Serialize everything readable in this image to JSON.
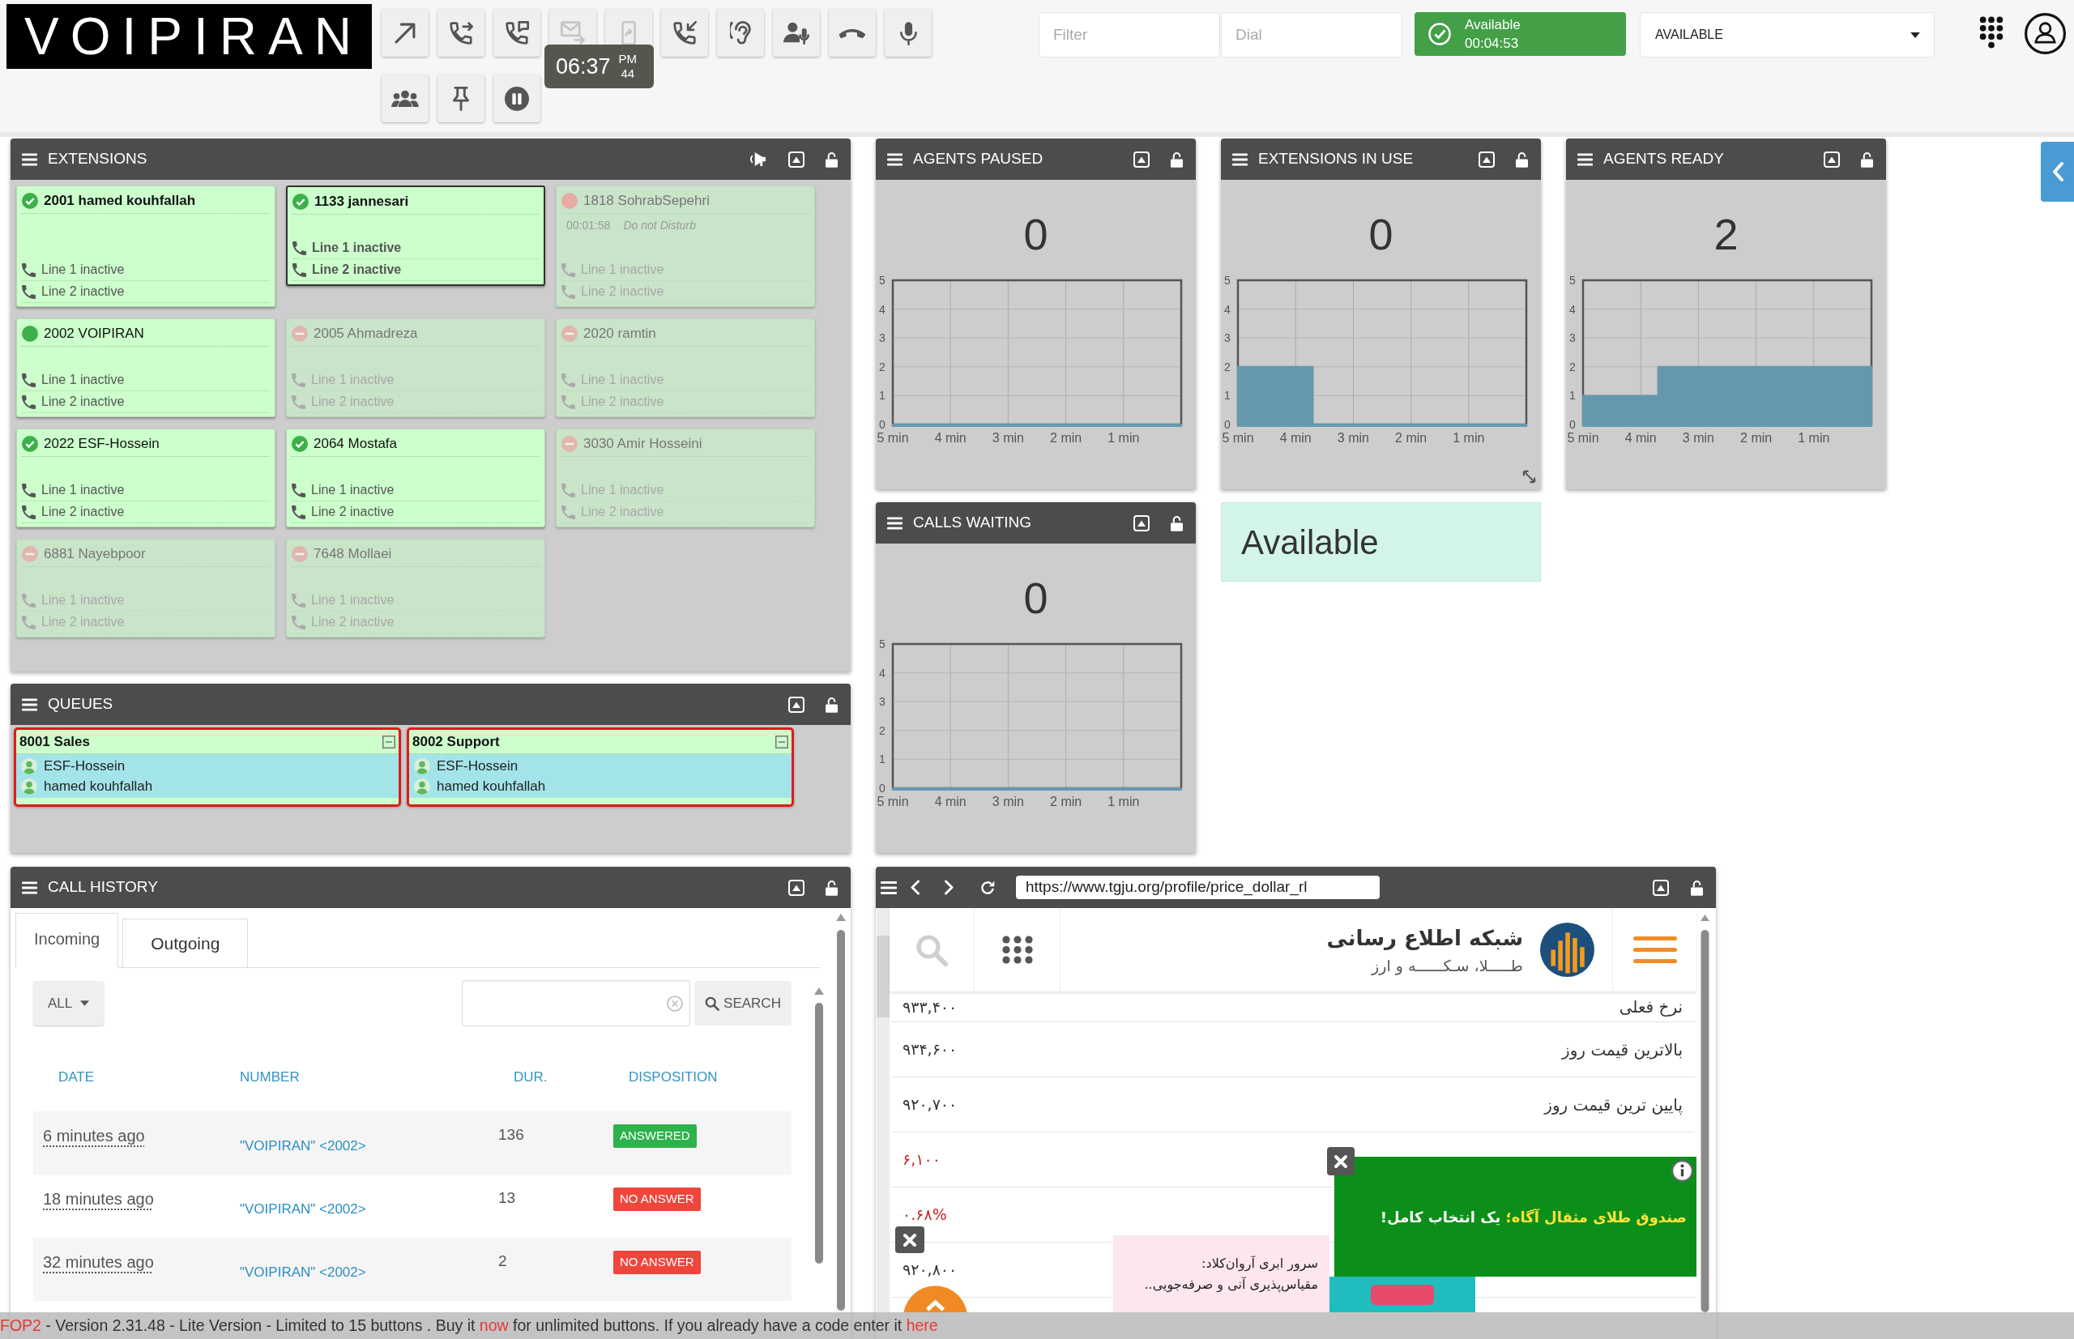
{
  "topbar": {
    "logo": "VOIPIRAN",
    "toolbar": [
      {
        "kind": "arrow",
        "disabled": false
      },
      {
        "kind": "transfer",
        "disabled": false
      },
      {
        "kind": "voicemail",
        "disabled": false
      },
      {
        "kind": "mail",
        "disabled": true
      },
      {
        "kind": "mobile",
        "disabled": true
      },
      {
        "kind": "pickup",
        "disabled": false
      },
      {
        "kind": "listen",
        "disabled": false
      },
      {
        "kind": "whisper",
        "disabled": false
      },
      {
        "kind": "hangup",
        "disabled": false
      },
      {
        "kind": "mic",
        "disabled": false
      },
      {
        "kind": "group",
        "disabled": false
      },
      {
        "kind": "pin",
        "disabled": false
      },
      {
        "kind": "pause",
        "disabled": false
      }
    ],
    "clock": {
      "time": "06:37",
      "period": "PM",
      "seconds": "44"
    },
    "filter": {
      "placeholder": "Filter"
    },
    "dial": {
      "placeholder": "Dial"
    },
    "presence_button": {
      "label": "Available",
      "timer": "00:04:53"
    },
    "presence_select": {
      "value": "AVAILABLE"
    }
  },
  "extensions": {
    "title": "EXTENSIONS",
    "items": [
      {
        "name": "2001 hamed kouhfallah",
        "kind": "available",
        "selected": false,
        "bold": true,
        "lines": [
          {
            "label": "Line 1 inactive",
            "bold": false
          },
          {
            "label": "Line 2 inactive",
            "bold": false
          }
        ]
      },
      {
        "name": "1133 jannesari",
        "kind": "available",
        "selected": true,
        "bold": true,
        "lines": [
          {
            "label": "Line 1 inactive",
            "bold": true
          },
          {
            "label": "Line 2 inactive",
            "bold": true
          }
        ]
      },
      {
        "name": "1818 SohrabSepehri",
        "kind": "dnd",
        "selected": false,
        "bold": false,
        "timer": "00:01:58",
        "note": "Do not Disturb",
        "lines": [
          {
            "label": "Line 1 inactive",
            "bold": false
          },
          {
            "label": "Line 2 inactive",
            "bold": false
          }
        ]
      },
      {
        "name": "2002 VOIPIRAN",
        "kind": "online",
        "selected": false,
        "bold": false,
        "lines": [
          {
            "label": "Line 1 inactive",
            "bold": false
          },
          {
            "label": "Line 2 inactive",
            "bold": false
          }
        ]
      },
      {
        "name": "2005 Ahmadreza",
        "kind": "offline",
        "selected": false,
        "bold": false,
        "lines": [
          {
            "label": "Line 1 inactive",
            "bold": false
          },
          {
            "label": "Line 2 inactive",
            "bold": false
          }
        ]
      },
      {
        "name": "2020 ramtin",
        "kind": "offline",
        "selected": false,
        "bold": false,
        "lines": [
          {
            "label": "Line 1 inactive",
            "bold": false
          },
          {
            "label": "Line 2 inactive",
            "bold": false
          }
        ]
      },
      {
        "name": "2022 ESF-Hossein",
        "kind": "available",
        "selected": false,
        "bold": false,
        "lines": [
          {
            "label": "Line 1 inactive",
            "bold": false
          },
          {
            "label": "Line 2 inactive",
            "bold": false
          }
        ]
      },
      {
        "name": "2064 Mostafa",
        "kind": "available",
        "selected": false,
        "bold": false,
        "lines": [
          {
            "label": "Line 1 inactive",
            "bold": false
          },
          {
            "label": "Line 2 inactive",
            "bold": false
          }
        ]
      },
      {
        "name": "3030 Amir Hosseini",
        "kind": "offline",
        "selected": false,
        "bold": false,
        "lines": [
          {
            "label": "Line 1 inactive",
            "bold": false
          },
          {
            "label": "Line 2 inactive",
            "bold": false
          }
        ]
      },
      {
        "name": "6881 Nayebpoor",
        "kind": "offline",
        "selected": false,
        "bold": false,
        "lines": [
          {
            "label": "Line 1 inactive",
            "bold": false
          },
          {
            "label": "Line 2 inactive",
            "bold": false
          }
        ]
      },
      {
        "name": "7648 Mollaei",
        "kind": "offline",
        "selected": false,
        "bold": false,
        "lines": [
          {
            "label": "Line 1 inactive",
            "bold": false
          },
          {
            "label": "Line 2 inactive",
            "bold": false
          }
        ]
      }
    ]
  },
  "queues": {
    "title": "QUEUES",
    "items": [
      {
        "name": "8001 Sales",
        "alert": true,
        "members": [
          "ESF-Hossein",
          "hamed kouhfallah"
        ]
      },
      {
        "name": "8002 Support",
        "alert": true,
        "members": [
          "ESF-Hossein",
          "hamed kouhfallah"
        ]
      }
    ]
  },
  "stats": [
    {
      "title": "AGENTS PAUSED",
      "value": "0",
      "resize_handle": false,
      "chart_data": {
        "type": "area",
        "grid": true,
        "x": [
          5,
          0
        ],
        "xlim": [
          5,
          0
        ],
        "ylim": [
          0,
          5
        ],
        "yticks": [
          0,
          1,
          2,
          3,
          4,
          5
        ],
        "xticks": [
          {
            "value": 5,
            "label": "5 min"
          },
          {
            "value": 4,
            "label": "4 min"
          },
          {
            "value": 3,
            "label": "3 min"
          },
          {
            "value": 2,
            "label": "2 min"
          },
          {
            "value": 1,
            "label": "1 min"
          }
        ],
        "series": [
          {
            "color": "#6598af",
            "values": [
              0,
              0
            ]
          }
        ]
      }
    },
    {
      "title": "EXTENSIONS IN USE",
      "value": "0",
      "resize_handle": true,
      "chart_data": {
        "type": "area",
        "grid": true,
        "x": [
          5,
          3.7,
          3.7,
          0
        ],
        "xlim": [
          5,
          0
        ],
        "ylim": [
          0,
          5
        ],
        "yticks": [
          0,
          1,
          2,
          3,
          4,
          5
        ],
        "xticks": [
          {
            "value": 5,
            "label": "5 min"
          },
          {
            "value": 4,
            "label": "4 min"
          },
          {
            "value": 3,
            "label": "3 min"
          },
          {
            "value": 2,
            "label": "2 min"
          },
          {
            "value": 1,
            "label": "1 min"
          }
        ],
        "series": [
          {
            "color": "#6598af",
            "values": [
              2,
              2,
              0,
              0
            ]
          }
        ]
      }
    },
    {
      "title": "AGENTS READY",
      "value": "2",
      "resize_handle": false,
      "chart_data": {
        "type": "area",
        "grid": true,
        "x": [
          5,
          3.7,
          3.7,
          0
        ],
        "xlim": [
          5,
          0
        ],
        "ylim": [
          0,
          5
        ],
        "yticks": [
          0,
          1,
          2,
          3,
          4,
          5
        ],
        "xticks": [
          {
            "value": 5,
            "label": "5 min"
          },
          {
            "value": 4,
            "label": "4 min"
          },
          {
            "value": 3,
            "label": "3 min"
          },
          {
            "value": 2,
            "label": "2 min"
          },
          {
            "value": 1,
            "label": "1 min"
          }
        ],
        "series": [
          {
            "color": "#6598af",
            "values": [
              1,
              1,
              2,
              2
            ]
          }
        ]
      }
    },
    {
      "title": "CALLS WAITING",
      "value": "0",
      "resize_handle": false,
      "chart_data": {
        "type": "area",
        "grid": true,
        "x": [
          5,
          0
        ],
        "xlim": [
          5,
          0
        ],
        "ylim": [
          0,
          5
        ],
        "yticks": [
          0,
          1,
          2,
          3,
          4,
          5
        ],
        "xticks": [
          {
            "value": 5,
            "label": "5 min"
          },
          {
            "value": 4,
            "label": "4 min"
          },
          {
            "value": 3,
            "label": "3 min"
          },
          {
            "value": 2,
            "label": "2 min"
          },
          {
            "value": 1,
            "label": "1 min"
          }
        ],
        "series": [
          {
            "color": "#6598af",
            "values": [
              0,
              0
            ]
          }
        ]
      }
    }
  ],
  "availability_banner": {
    "text": "Available"
  },
  "call_history": {
    "title": "CALL HISTORY",
    "tabs": [
      {
        "label": "Incoming",
        "selected": true
      },
      {
        "label": "Outgoing",
        "selected": false
      }
    ],
    "direction_filter": {
      "value": "ALL"
    },
    "search": {
      "button": "SEARCH"
    },
    "columns": [
      "DATE",
      "NUMBER",
      "DUR.",
      "DISPOSITION"
    ],
    "rows": [
      {
        "date": "6 minutes ago",
        "number": "\"VOIPIRAN\" <2002>",
        "duration": "136",
        "disposition": {
          "label": "ANSWERED",
          "kind": "answered"
        }
      },
      {
        "date": "18 minutes ago",
        "number": "\"VOIPIRAN\" <2002>",
        "duration": "13",
        "disposition": {
          "label": "NO ANSWER",
          "kind": "no_answer"
        }
      },
      {
        "date": "32 minutes ago",
        "number": "\"VOIPIRAN\" <2002>",
        "duration": "2",
        "disposition": {
          "label": "NO ANSWER",
          "kind": "no_answer"
        }
      }
    ]
  },
  "browser": {
    "url": "https://www.tgju.org/profile/price_dollar_rl",
    "site": {
      "title": "شبکه اطلاع رسانی",
      "subtitle": "طـــــلا، سـکــــــه و ارز",
      "rows": [
        {
          "value": "۹۳۳,۴۰۰",
          "label": "نرخ فعلی",
          "change": false
        },
        {
          "value": "۹۳۴,۶۰۰",
          "label": "بالاترین قیمت روز",
          "change": false
        },
        {
          "value": "۹۲۰,۷۰۰",
          "label": "پایین ترین قیمت روز",
          "change": false
        },
        {
          "value": "۶,۱۰۰",
          "change": true
        },
        {
          "value": "۰.۶۸%",
          "change": true
        },
        {
          "value": "۹۲۰,۸۰۰",
          "change": false
        }
      ]
    },
    "ads": [
      {
        "kind": "banner",
        "highlight": "صندوق طلای مثقال آگاه؛",
        "text": "یک انتخاب کامل!"
      },
      {
        "kind": "card",
        "lines": [
          "سرور ابری آروان‌کلاد:",
          "مقیاس‌پذیری آنی و صرفه‌جویی.."
        ]
      }
    ]
  },
  "status_bar": {
    "parts": [
      {
        "kind": "link",
        "text": "FOP2"
      },
      {
        "kind": "text",
        "text": "- Version 2.31.48 - Lite Version - Limited to 15 buttons . Buy it"
      },
      {
        "kind": "link",
        "text": "now"
      },
      {
        "kind": "text",
        "text": "for unlimited buttons. If you already have a code enter it"
      },
      {
        "kind": "link",
        "text": "here"
      }
    ]
  }
}
